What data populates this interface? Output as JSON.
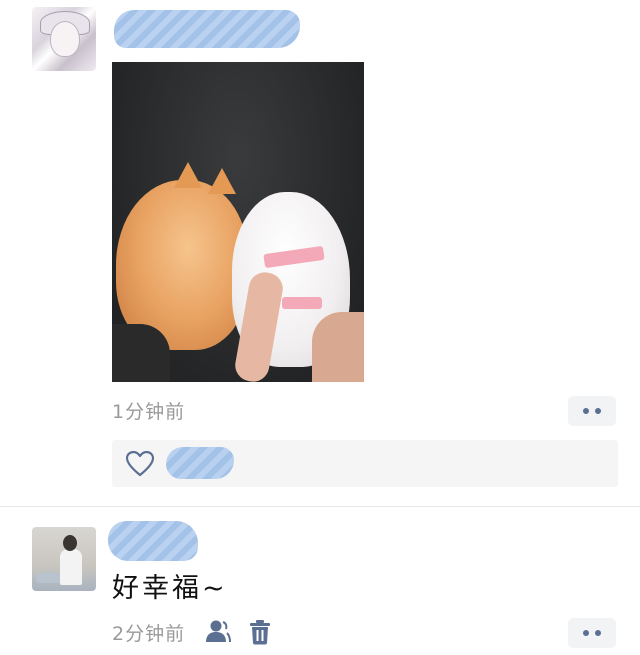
{
  "posts": [
    {
      "time": "1分钟前",
      "image": "kittens-photo",
      "likes_icon": "heart-outline-icon"
    },
    {
      "comment": "好幸福~",
      "time": "2分钟前",
      "icons": [
        "user-visibility-icon",
        "trash-icon"
      ]
    }
  ],
  "colors": {
    "accent": "#5b6f93",
    "time_text": "#9a9a9a",
    "redaction": "#9fbfe6"
  }
}
